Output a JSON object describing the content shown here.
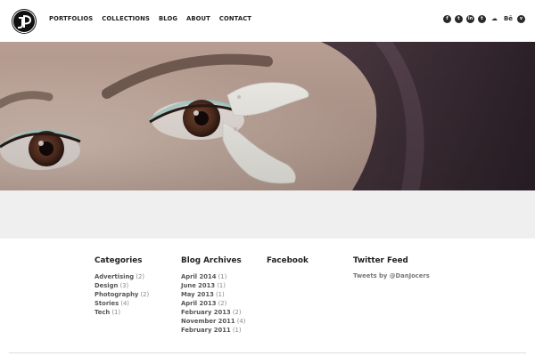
{
  "nav": {
    "items": [
      "PORTFOLIOS",
      "COLLECTIONS",
      "BLOG",
      "ABOUT",
      "CONTACT"
    ]
  },
  "social": {
    "icons": [
      "facebook-icon",
      "twitter-icon",
      "linkedin-icon",
      "tumblr-icon",
      "soundcloud-icon",
      "behance-icon",
      "vimeo-icon"
    ],
    "labels": {
      "facebook": "f",
      "twitter": "t",
      "linkedin": "in",
      "tumblr": "t",
      "soundcloud": "☁",
      "behance": "Bē",
      "vimeo": "v"
    }
  },
  "footer": {
    "categories": {
      "title": "Categories",
      "items": [
        {
          "label": "Advertising",
          "count": "(2)"
        },
        {
          "label": "Design",
          "count": "(3)"
        },
        {
          "label": "Photography",
          "count": "(2)"
        },
        {
          "label": "Stories",
          "count": "(4)"
        },
        {
          "label": "Tech",
          "count": "(1)"
        }
      ]
    },
    "archives": {
      "title": "Blog Archives",
      "items": [
        {
          "label": "April 2014",
          "count": "(1)"
        },
        {
          "label": "June 2013",
          "count": "(1)"
        },
        {
          "label": "May 2013",
          "count": "(1)"
        },
        {
          "label": "April 2013",
          "count": "(2)"
        },
        {
          "label": "February 2013",
          "count": "(2)"
        },
        {
          "label": "November 2011",
          "count": "(4)"
        },
        {
          "label": "February 2011",
          "count": "(1)"
        }
      ]
    },
    "facebook": {
      "title": "Facebook"
    },
    "twitter": {
      "title": "Twitter Feed",
      "link": "Tweets by @DanJocers"
    }
  },
  "colors": {
    "header_bg": "#ffffff",
    "band_bg": "#efefef",
    "text_dark": "#222222",
    "text_muted": "#888888"
  }
}
